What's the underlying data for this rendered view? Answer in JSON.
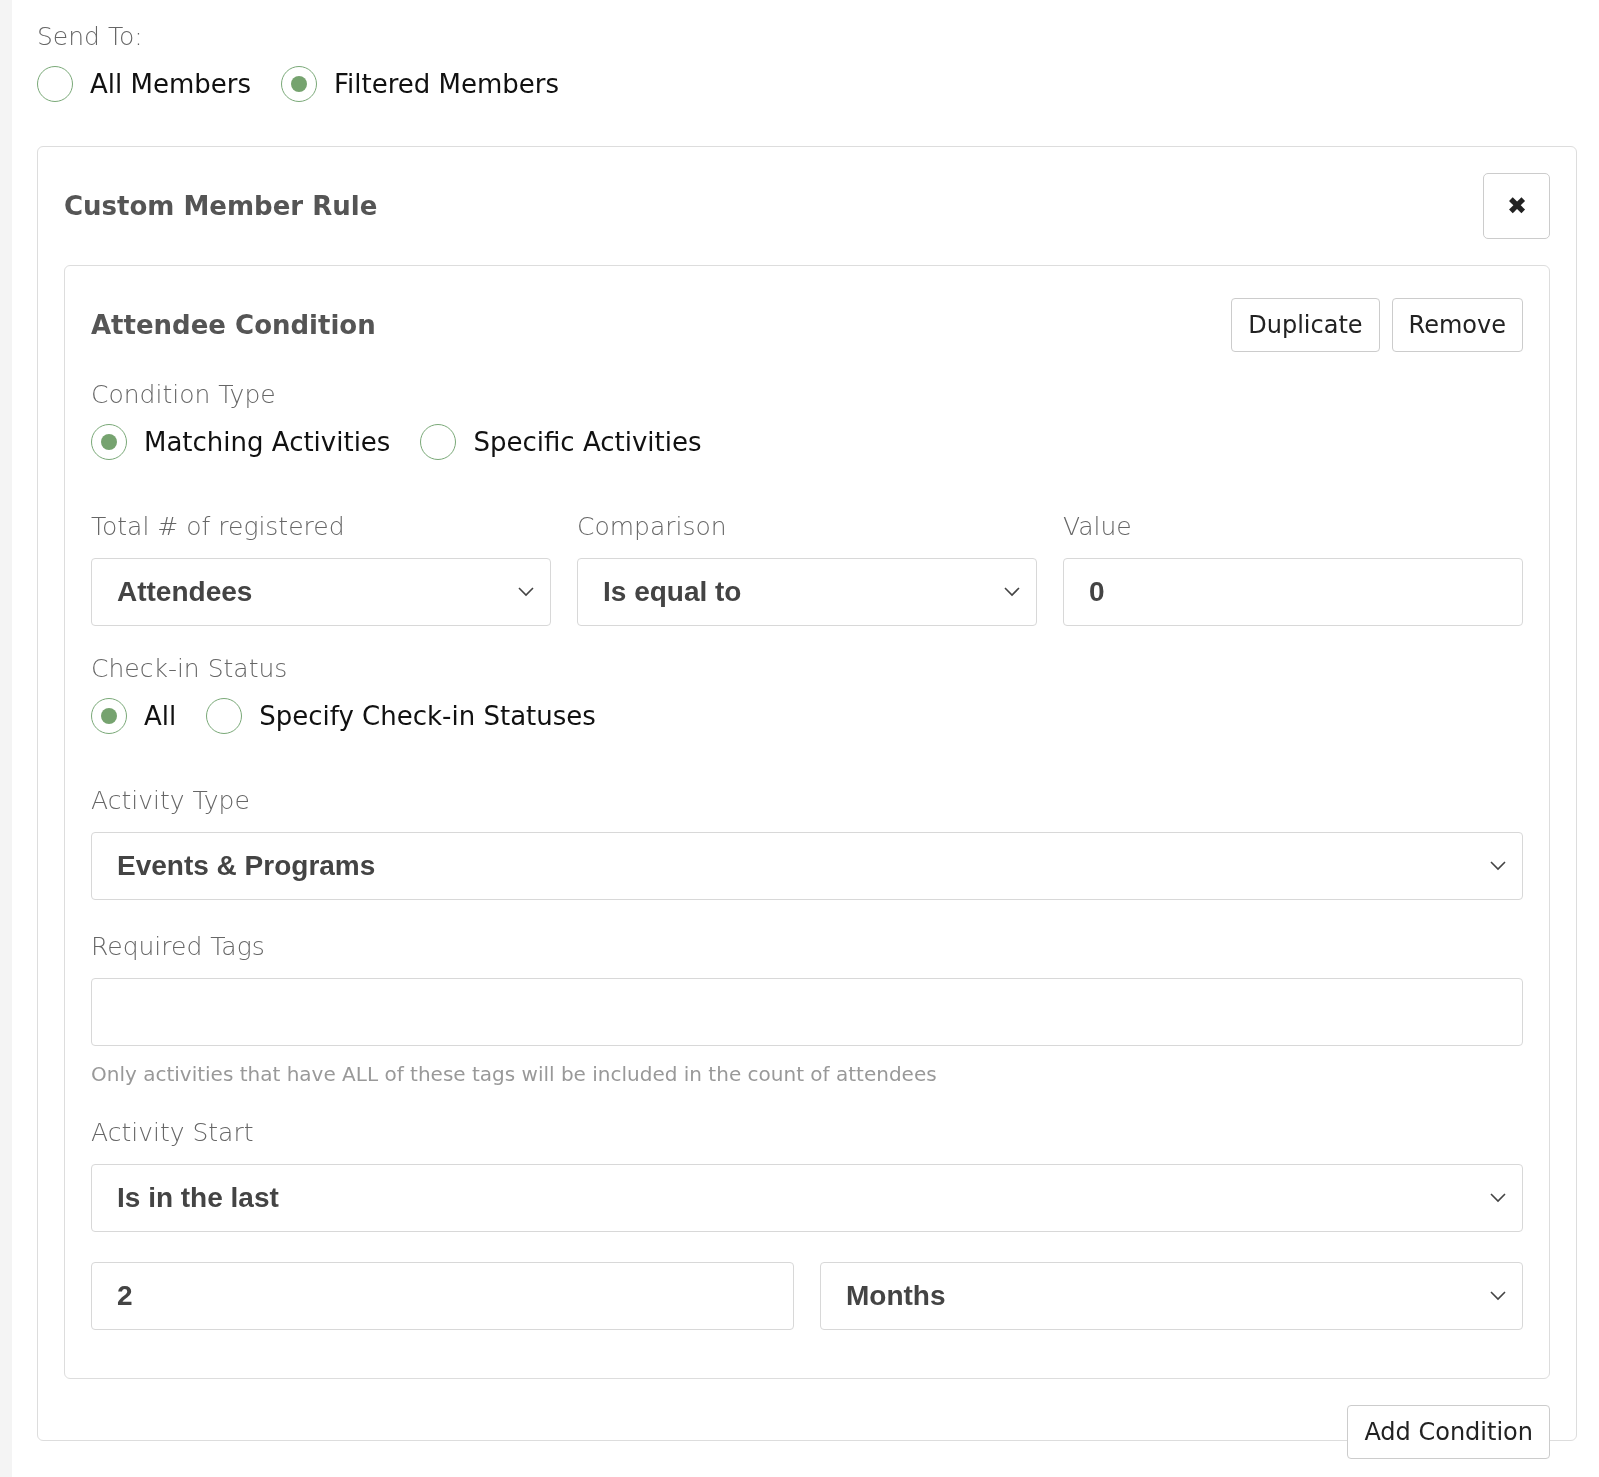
{
  "send_to": {
    "label": "Send To:",
    "options": [
      {
        "label": "All Members",
        "selected": false
      },
      {
        "label": "Filtered Members",
        "selected": true
      }
    ]
  },
  "rule": {
    "title": "Custom Member Rule",
    "close": "✖",
    "conditions": [
      {
        "title": "Attendee Condition",
        "buttons": [
          "Duplicate",
          "Remove"
        ],
        "sections": [
          {
            "kind": "radios",
            "label": "Condition Type",
            "options": [
              {
                "label": "Matching Activities",
                "selected": true
              },
              {
                "label": "Specific Activities",
                "selected": false
              }
            ]
          },
          {
            "kind": "fields",
            "fields": [
              {
                "label": "Total # of registered",
                "kind": "select",
                "value": "Attendees"
              },
              {
                "label": "Comparison",
                "kind": "select",
                "value": "Is equal to"
              },
              {
                "label": "Value",
                "kind": "input",
                "value": "0"
              }
            ]
          },
          {
            "kind": "radios",
            "label": "Check-in Status",
            "options": [
              {
                "label": "All",
                "selected": true
              },
              {
                "label": "Specify Check-in Statuses",
                "selected": false
              }
            ]
          },
          {
            "kind": "fields",
            "fields": [
              {
                "label": "Activity Type",
                "kind": "select",
                "value": "Events & Programs"
              }
            ]
          },
          {
            "kind": "fields",
            "fields": [
              {
                "label": "Required Tags",
                "kind": "input",
                "hint": "Only activities that have ALL of these tags will be included in the count of attendees"
              }
            ]
          },
          {
            "kind": "fields",
            "fields": [
              {
                "label": "Activity Start",
                "kind": "select",
                "value": "Is in the last"
              }
            ]
          },
          {
            "kind": "fields",
            "fields": [
              {
                "kind": "input",
                "value": "2"
              },
              {
                "kind": "select",
                "value": "Months"
              }
            ]
          }
        ]
      }
    ],
    "add_button": "Add Condition"
  }
}
